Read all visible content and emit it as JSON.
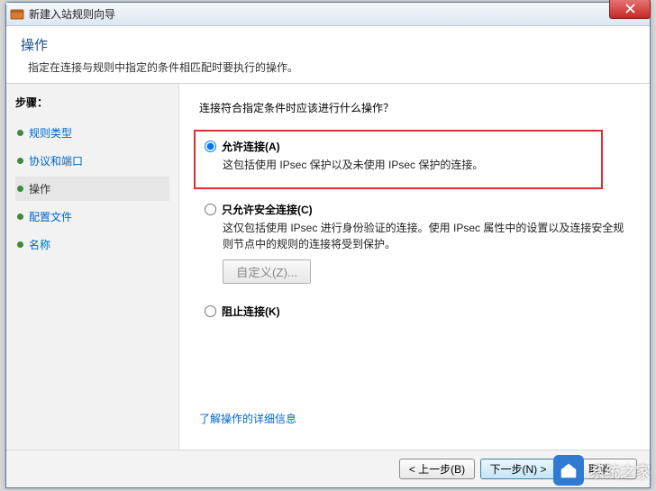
{
  "window": {
    "title": "新建入站规则向导"
  },
  "header": {
    "title": "操作",
    "desc": "指定在连接与规则中指定的条件相匹配时要执行的操作。"
  },
  "sidebar": {
    "label": "步骤：",
    "items": [
      {
        "label": "规则类型"
      },
      {
        "label": "协议和端口"
      },
      {
        "label": "操作"
      },
      {
        "label": "配置文件"
      },
      {
        "label": "名称"
      }
    ]
  },
  "main": {
    "question": "连接符合指定条件时应该进行什么操作？",
    "options": {
      "allow": {
        "label": "允许连接(A)",
        "desc": "这包括使用 IPsec 保护以及未使用 IPsec 保护的连接。"
      },
      "secure": {
        "label": "只允许安全连接(C)",
        "desc": "这仅包括使用 IPsec 进行身份验证的连接。使用 IPsec 属性中的设置以及连接安全规则节点中的规则的连接将受到保护。",
        "customize_btn": "自定义(Z)..."
      },
      "block": {
        "label": "阻止连接(K)"
      }
    },
    "help_link": "了解操作的详细信息"
  },
  "footer": {
    "back": "< 上一步(B)",
    "next": "下一步(N) >",
    "cancel": "取消"
  },
  "watermark": "系统之家"
}
